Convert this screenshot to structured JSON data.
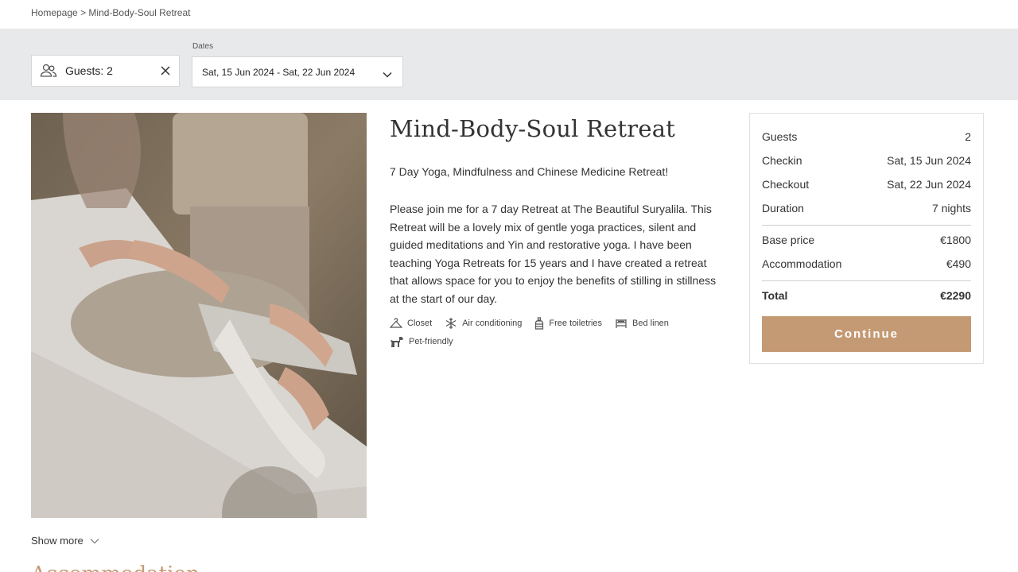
{
  "breadcrumb": {
    "home": "Homepage",
    "separator": ">",
    "current": "Mind-Body-Soul Retreat"
  },
  "filters": {
    "guests_label": "Guests: 2",
    "dates_label": "Dates",
    "dates_value": "Sat, 15 Jun 2024 - Sat, 22 Jun 2024"
  },
  "retreat": {
    "title": "Mind-Body-Soul Retreat",
    "subtitle": "7 Day Yoga, Mindfulness and Chinese Medicine Retreat!",
    "description": "Please join me for a 7 day Retreat at The Beautiful Suryalila. This Retreat will be a lovely mix of gentle yoga practices, silent and guided meditations and Yin and restorative yoga. I have been teaching Yoga Retreats for 15 years and I have created a retreat that allows space for you to enjoy the benefits of stilling in stillness at the start of our day.",
    "amenities": [
      {
        "label": "Closet",
        "icon": "hanger-icon"
      },
      {
        "label": "Air conditioning",
        "icon": "snowflake-icon"
      },
      {
        "label": "Free toiletries",
        "icon": "bottle-icon"
      },
      {
        "label": "Bed linen",
        "icon": "bed-icon"
      },
      {
        "label": "Pet-friendly",
        "icon": "dog-icon"
      }
    ]
  },
  "summary": {
    "guests_label": "Guests",
    "guests_value": "2",
    "checkin_label": "Checkin",
    "checkin_value": "Sat, 15 Jun 2024",
    "checkout_label": "Checkout",
    "checkout_value": "Sat, 22 Jun 2024",
    "duration_label": "Duration",
    "duration_value": "7 nights",
    "base_label": "Base price",
    "base_value": "€1800",
    "accom_label": "Accommodation",
    "accom_value": "€490",
    "total_label": "Total",
    "total_value": "€2290",
    "continue_label": "Continue"
  },
  "show_more": "Show more",
  "next_section_heading": "Accommodation",
  "colors": {
    "accent": "#c49a74",
    "filterbar": "#e8e9eb",
    "text": "#333333"
  }
}
